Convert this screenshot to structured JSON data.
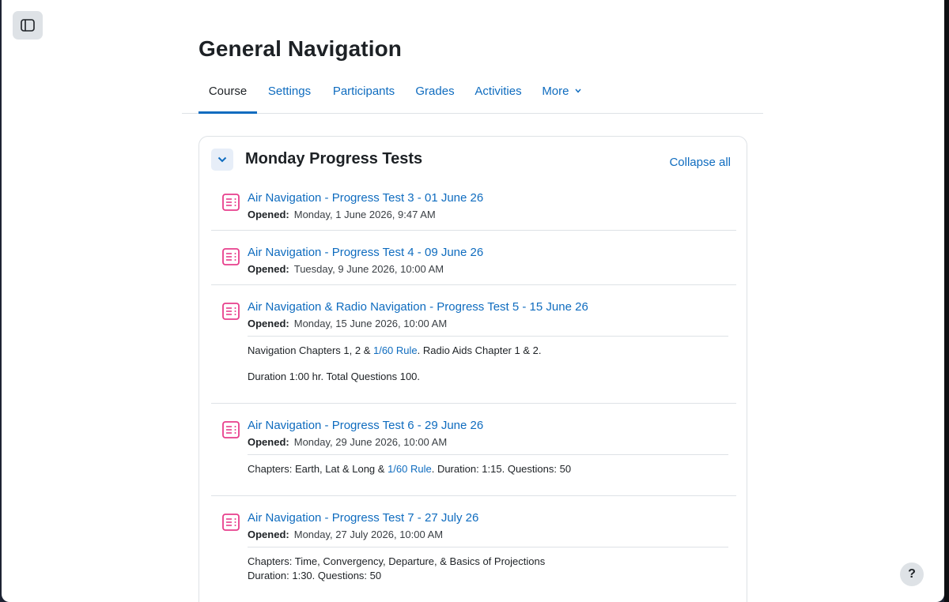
{
  "page": {
    "title": "General Navigation"
  },
  "tabs": [
    {
      "label": "Course",
      "active": true
    },
    {
      "label": "Settings"
    },
    {
      "label": "Participants"
    },
    {
      "label": "Grades"
    },
    {
      "label": "Activities"
    },
    {
      "label": "More"
    }
  ],
  "section": {
    "title": "Monday Progress Tests",
    "collapse_all_label": "Collapse all"
  },
  "activities": [
    {
      "name": "Air Navigation - Progress Test 3 - 01 June 26",
      "opened_label": "Opened:",
      "opened_date": "Monday, 1 June 2026, 9:47 AM"
    },
    {
      "name": "Air Navigation - Progress Test 4 - 09 June 26",
      "opened_label": "Opened:",
      "opened_date": "Tuesday, 9 June 2026, 10:00 AM"
    },
    {
      "name": "Air Navigation & Radio Navigation - Progress Test 5 - 15 June 26",
      "opened_label": "Opened:",
      "opened_date": "Monday, 15 June 2026, 10:00 AM",
      "desc": {
        "line1_pre": "Navigation Chapters 1, 2 & ",
        "line1_link": "1/60 Rule",
        "line1_post": ". Radio Aids Chapter 1 & 2.",
        "line2": "Duration 1:00 hr. Total Questions 100."
      }
    },
    {
      "name": "Air Navigation - Progress Test 6 - 29 June 26",
      "opened_label": "Opened:",
      "opened_date": "Monday, 29 June 2026, 10:00 AM",
      "desc": {
        "line1_pre": "Chapters: Earth, Lat & Long & ",
        "line1_link": "1/60 Rule",
        "line1_post": ". Duration: 1:15. Questions: 50"
      }
    },
    {
      "name": "Air Navigation - Progress Test 7 - 27 July 26",
      "opened_label": "Opened:",
      "opened_date": "Monday, 27 July 2026, 10:00 AM",
      "desc": {
        "line1": "Chapters: Time, Convergency, Departure, & Basics of Projections",
        "line2": "Duration: 1:30. Questions: 50"
      }
    }
  ],
  "help": {
    "label": "?"
  },
  "colors": {
    "link": "#0f6cbf",
    "quiz_icon": "#e83e8c",
    "text": "#1d2125"
  }
}
